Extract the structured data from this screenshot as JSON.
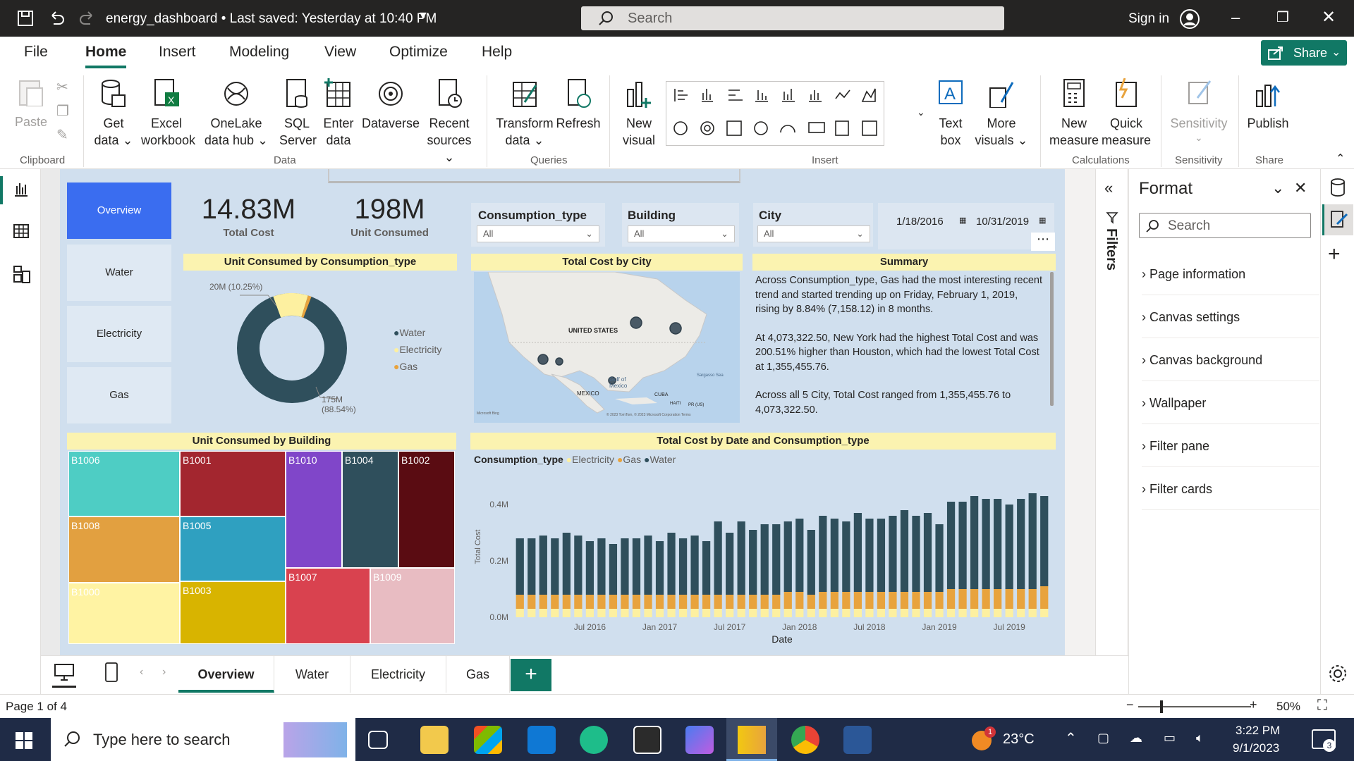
{
  "window": {
    "title": "energy_dashboard • Last saved: Yesterday at 10:40 PM",
    "search_placeholder": "Search",
    "sign_in": "Sign in"
  },
  "menu": [
    "File",
    "Home",
    "Insert",
    "Modeling",
    "View",
    "Optimize",
    "Help"
  ],
  "share_label": "Share",
  "ribbon": {
    "clipboard": {
      "paste": "Paste",
      "group": "Clipboard"
    },
    "data": {
      "get_data": "Get data ⌄",
      "excel": "Excel workbook",
      "onelake": "OneLake data hub ⌄",
      "sql": "SQL Server",
      "enter": "Enter data",
      "dataverse": "Dataverse",
      "recent": "Recent sources ⌄",
      "group": "Data"
    },
    "queries": {
      "transform": "Transform data ⌄",
      "refresh": "Refresh",
      "group": "Queries"
    },
    "insert": {
      "new_visual": "New visual",
      "text_box": "Text box",
      "more_visuals": "More visuals ⌄",
      "group": "Insert"
    },
    "calc": {
      "new_measure": "New measure",
      "quick_measure": "Quick measure",
      "group": "Calculations"
    },
    "sensitivity": {
      "label": "Sensitivity",
      "group": "Sensitivity"
    },
    "share": {
      "publish": "Publish",
      "group": "Share"
    }
  },
  "nav": {
    "overview": "Overview",
    "water": "Water",
    "electricity": "Electricity",
    "gas": "Gas",
    "active_color": "#3a6df0"
  },
  "kpi": {
    "total_cost_value": "14.83M",
    "total_cost_label": "Total Cost",
    "unit_value": "198M",
    "unit_label": "Unit Consumed"
  },
  "slicers": {
    "consumption_type": {
      "label": "Consumption_type",
      "value": "All"
    },
    "building": {
      "label": "Building",
      "value": "All"
    },
    "city": {
      "label": "City",
      "value": "All"
    },
    "date_from": "1/18/2016",
    "date_to": "10/31/2019"
  },
  "donut": {
    "title": "Unit Consumed by Consumption_type",
    "label_top": "20M (10.25%)",
    "label_bottom_1": "175M",
    "label_bottom_2": "(88.54%)",
    "legend": [
      {
        "name": "Water",
        "color": "#2f4f5c"
      },
      {
        "name": "Electricity",
        "color": "#fdf0a0"
      },
      {
        "name": "Gas",
        "color": "#e8a33d"
      }
    ]
  },
  "map": {
    "title": "Total Cost by City",
    "labels": {
      "usa": "UNITED STATES",
      "mexico": "MEXICO",
      "cuba": "CUBA",
      "gulf": "Gulf of Mexico",
      "sargasso": "Sargasso Sea",
      "haiti": "HAITI",
      "pr": "PR (US)",
      "bing": "Microsoft Bing",
      "copyright": "© 2023 TomTom, © 2023 Microsoft Corporation Terms"
    }
  },
  "summary": {
    "title": "Summary",
    "p1": "Across Consumption_type, Gas had the most interesting recent trend and started trending up on Friday, February 1, 2019, rising by 8.84% (7,158.12) in 8 months.",
    "p2": "At 4,073,322.50, New York had the highest Total Cost and was 200.51% higher than Houston, which had the lowest Total Cost at 1,355,455.76.",
    "p3": "Across all 5 City, Total Cost ranged from 1,355,455.76 to 4,073,322.50."
  },
  "treemap": {
    "title": "Unit Consumed by Building",
    "tiles": [
      {
        "name": "B1006",
        "color": "#4ecdc4"
      },
      {
        "name": "B1001",
        "color": "#a3262f"
      },
      {
        "name": "B1010",
        "color": "#8046c9"
      },
      {
        "name": "B1004",
        "color": "#2f4f5c"
      },
      {
        "name": "B1002",
        "color": "#5a0c12"
      },
      {
        "name": "B1008",
        "color": "#e2a040"
      },
      {
        "name": "B1005",
        "color": "#2fa0c0"
      },
      {
        "name": "B1007",
        "color": "#d9424f"
      },
      {
        "name": "B1009",
        "color": "#e8bcc2"
      },
      {
        "name": "B1000",
        "color": "#fff3a3"
      },
      {
        "name": "B1003",
        "color": "#d8b400"
      }
    ]
  },
  "chart_title": "Total Cost by Date and Consumption_type",
  "chart_legend_title": "Consumption_type",
  "chart_data": {
    "type": "bar",
    "stacked": true,
    "title": "Total Cost by Date and Consumption_type",
    "xlabel": "Date",
    "ylabel": "Total Cost",
    "yticks": [
      "0.0M",
      "0.2M",
      "0.4M"
    ],
    "ylim": [
      0,
      0.5
    ],
    "xticks": [
      "Jul 2016",
      "Jan 2017",
      "Jul 2017",
      "Jan 2018",
      "Jul 2018",
      "Jan 2019",
      "Jul 2019"
    ],
    "categories": [
      "2016-01",
      "2016-02",
      "2016-03",
      "2016-04",
      "2016-05",
      "2016-06",
      "2016-07",
      "2016-08",
      "2016-09",
      "2016-10",
      "2016-11",
      "2016-12",
      "2017-01",
      "2017-02",
      "2017-03",
      "2017-04",
      "2017-05",
      "2017-06",
      "2017-07",
      "2017-08",
      "2017-09",
      "2017-10",
      "2017-11",
      "2017-12",
      "2018-01",
      "2018-02",
      "2018-03",
      "2018-04",
      "2018-05",
      "2018-06",
      "2018-07",
      "2018-08",
      "2018-09",
      "2018-10",
      "2018-11",
      "2018-12",
      "2019-01",
      "2019-02",
      "2019-03",
      "2019-04",
      "2019-05",
      "2019-06",
      "2019-07",
      "2019-08",
      "2019-09",
      "2019-10"
    ],
    "series": [
      {
        "name": "Electricity",
        "color": "#fdf0a0",
        "values": [
          0.03,
          0.03,
          0.03,
          0.03,
          0.03,
          0.03,
          0.03,
          0.03,
          0.03,
          0.03,
          0.03,
          0.03,
          0.03,
          0.03,
          0.03,
          0.03,
          0.03,
          0.03,
          0.03,
          0.03,
          0.03,
          0.03,
          0.03,
          0.03,
          0.03,
          0.03,
          0.03,
          0.03,
          0.03,
          0.03,
          0.03,
          0.03,
          0.03,
          0.03,
          0.03,
          0.03,
          0.03,
          0.03,
          0.03,
          0.03,
          0.03,
          0.03,
          0.03,
          0.03,
          0.03,
          0.03
        ]
      },
      {
        "name": "Gas",
        "color": "#e8a33d",
        "values": [
          0.05,
          0.05,
          0.05,
          0.05,
          0.05,
          0.05,
          0.05,
          0.05,
          0.05,
          0.05,
          0.05,
          0.05,
          0.05,
          0.05,
          0.05,
          0.05,
          0.05,
          0.05,
          0.05,
          0.05,
          0.05,
          0.05,
          0.05,
          0.06,
          0.06,
          0.05,
          0.06,
          0.06,
          0.06,
          0.06,
          0.06,
          0.06,
          0.06,
          0.06,
          0.06,
          0.06,
          0.06,
          0.07,
          0.07,
          0.07,
          0.07,
          0.07,
          0.07,
          0.07,
          0.07,
          0.08
        ]
      },
      {
        "name": "Water",
        "color": "#2f4f5c",
        "values": [
          0.2,
          0.2,
          0.21,
          0.2,
          0.22,
          0.21,
          0.19,
          0.2,
          0.18,
          0.2,
          0.2,
          0.21,
          0.19,
          0.22,
          0.2,
          0.21,
          0.19,
          0.26,
          0.22,
          0.26,
          0.23,
          0.25,
          0.25,
          0.25,
          0.26,
          0.23,
          0.27,
          0.26,
          0.25,
          0.28,
          0.26,
          0.26,
          0.27,
          0.29,
          0.27,
          0.28,
          0.24,
          0.31,
          0.31,
          0.33,
          0.32,
          0.32,
          0.3,
          0.32,
          0.34,
          0.32
        ]
      }
    ]
  },
  "filters_label": "Filters",
  "format": {
    "title": "Format",
    "search_placeholder": "Search",
    "items": [
      "Page information",
      "Canvas settings",
      "Canvas background",
      "Wallpaper",
      "Filter pane",
      "Filter cards"
    ]
  },
  "page_tabs": [
    "Overview",
    "Water",
    "Electricity",
    "Gas"
  ],
  "status": {
    "page": "Page 1 of 4",
    "zoom": "50%"
  },
  "taskbar": {
    "search_placeholder": "Type here to search",
    "temp": "23°C",
    "time": "3:22 PM",
    "date": "9/1/2023",
    "notif": "3",
    "weather_badge": "1"
  }
}
